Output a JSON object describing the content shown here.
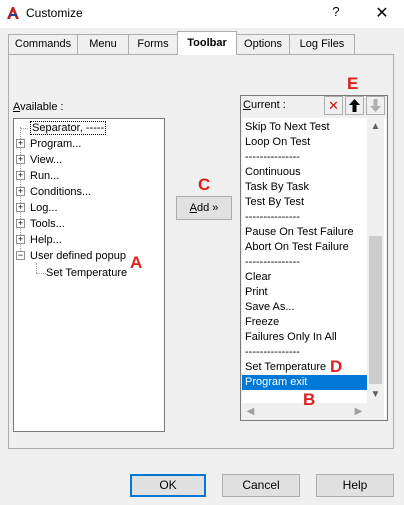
{
  "window": {
    "title": "Customize",
    "help_glyph": "?",
    "close_glyph": "✕"
  },
  "tabs": [
    {
      "label": "Commands"
    },
    {
      "label": "Menu"
    },
    {
      "label": "Forms"
    },
    {
      "label": "Toolbar",
      "active": true
    },
    {
      "label": "Options"
    },
    {
      "label": "Log Files"
    }
  ],
  "available": {
    "label_underlined": "A",
    "label_rest": "vailable :",
    "items": [
      {
        "label": "Separator, -----",
        "expandable": false
      },
      {
        "label": "Program...",
        "expandable": true
      },
      {
        "label": "View...",
        "expandable": true
      },
      {
        "label": "Run...",
        "expandable": true
      },
      {
        "label": "Conditions...",
        "expandable": true
      },
      {
        "label": "Log...",
        "expandable": true
      },
      {
        "label": "Tools...",
        "expandable": true
      },
      {
        "label": "Help...",
        "expandable": true
      },
      {
        "label": "User defined popup",
        "expandable": true,
        "expanded": true
      },
      {
        "label": "Set Temperature",
        "expandable": false,
        "child": true
      }
    ]
  },
  "add_button": {
    "underlined": "A",
    "rest": "dd »"
  },
  "current": {
    "label_underlined": "C",
    "label_rest": "urrent :",
    "items": [
      "Skip To Next Test",
      "Loop On Test",
      "---------------",
      "Continuous",
      "Task By Task",
      "Test By Test",
      "---------------",
      "Pause On Test Failure",
      "Abort On Test Failure",
      "---------------",
      "Clear",
      "Print",
      "Save As...",
      "Freeze",
      "Failures Only In All",
      "---------------",
      "Set Temperature",
      "Program exit"
    ],
    "selected_index": 17,
    "toolbar": {
      "delete_icon": "✕",
      "move_up_icon": "🡅",
      "move_down_icon": "🡇"
    }
  },
  "scrollbar": {
    "up": "▲",
    "down": "▼",
    "left": "◀",
    "right": "▶"
  },
  "annotations": {
    "a": "A",
    "b": "B",
    "c": "C",
    "d": "D",
    "e": "E"
  },
  "footer": {
    "ok": "OK",
    "cancel": "Cancel",
    "help": "Help"
  },
  "colors": {
    "selection": "#0078d7",
    "annotation": "#e02020",
    "delete_icon": "#d01010"
  }
}
